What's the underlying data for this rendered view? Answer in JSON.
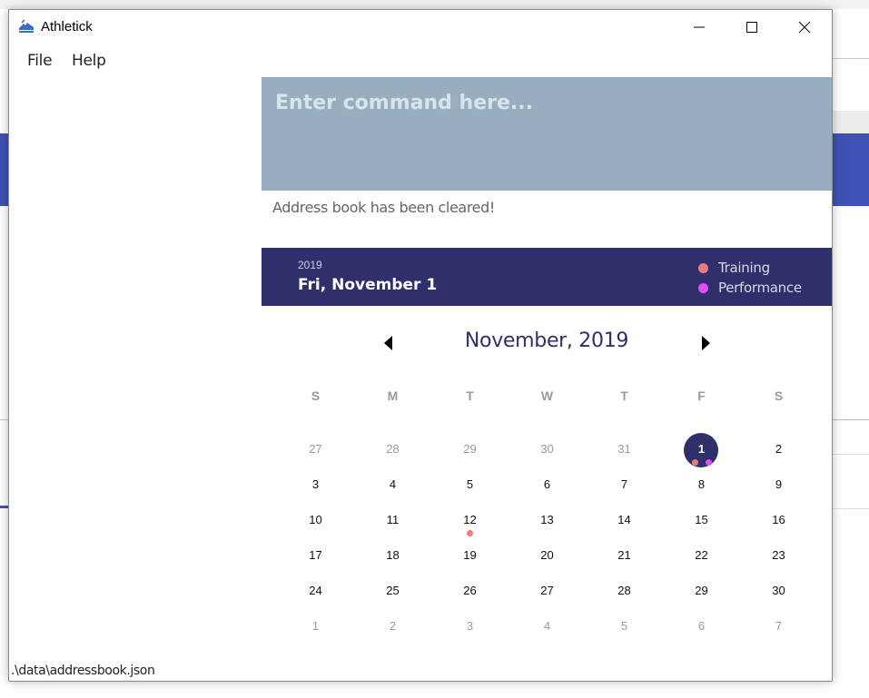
{
  "window": {
    "title": "Athletick",
    "icon": "athletick-shoe-icon"
  },
  "menu": {
    "items": [
      {
        "label": "File"
      },
      {
        "label": "Help"
      }
    ]
  },
  "command_box": {
    "placeholder": "Enter command here...",
    "value": ""
  },
  "result_display": {
    "message": "Address book has been cleared!"
  },
  "date_header": {
    "year": "2019",
    "date": "Fri, November 1",
    "legend": [
      {
        "label": "Training",
        "color": "#f07a7a"
      },
      {
        "label": "Performance",
        "color": "#e04ff0"
      }
    ]
  },
  "calendar": {
    "month_title": "November, 2019",
    "weekdays": [
      "S",
      "M",
      "T",
      "W",
      "T",
      "F",
      "S"
    ],
    "weeks": [
      [
        {
          "day": "27",
          "other": true
        },
        {
          "day": "28",
          "other": true
        },
        {
          "day": "29",
          "other": true
        },
        {
          "day": "30",
          "other": true
        },
        {
          "day": "31",
          "other": true
        },
        {
          "day": "1",
          "selected": true,
          "events": [
            "training",
            "performance"
          ]
        },
        {
          "day": "2"
        }
      ],
      [
        {
          "day": "3"
        },
        {
          "day": "4"
        },
        {
          "day": "5"
        },
        {
          "day": "6"
        },
        {
          "day": "7"
        },
        {
          "day": "8"
        },
        {
          "day": "9"
        }
      ],
      [
        {
          "day": "10"
        },
        {
          "day": "11"
        },
        {
          "day": "12",
          "events": [
            "training"
          ]
        },
        {
          "day": "13"
        },
        {
          "day": "14"
        },
        {
          "day": "15"
        },
        {
          "day": "16"
        }
      ],
      [
        {
          "day": "17"
        },
        {
          "day": "18"
        },
        {
          "day": "19"
        },
        {
          "day": "20"
        },
        {
          "day": "21"
        },
        {
          "day": "22"
        },
        {
          "day": "23"
        }
      ],
      [
        {
          "day": "24"
        },
        {
          "day": "25"
        },
        {
          "day": "26"
        },
        {
          "day": "27"
        },
        {
          "day": "28"
        },
        {
          "day": "29"
        },
        {
          "day": "30"
        }
      ],
      [
        {
          "day": "1",
          "other": true
        },
        {
          "day": "2",
          "other": true
        },
        {
          "day": "3",
          "other": true
        },
        {
          "day": "4",
          "other": true
        },
        {
          "day": "5",
          "other": true
        },
        {
          "day": "6",
          "other": true
        },
        {
          "day": "7",
          "other": true
        }
      ]
    ]
  },
  "status_bar": {
    "path": ".\\data\\addressbook.json"
  },
  "colors": {
    "accent": "#2f2f6b",
    "command_bg": "#96aec0",
    "training": "#f07a7a",
    "performance": "#e04ff0"
  }
}
